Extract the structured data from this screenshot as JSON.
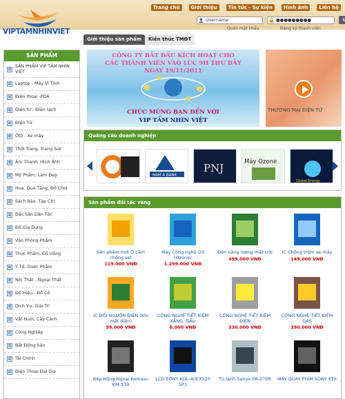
{
  "brand": {
    "logo_text": "VIPTAMNHINVIET"
  },
  "nav": [
    "Trang chủ",
    "Giới thiệu",
    "Tin tức - Sự kiện",
    "Hình ảnh",
    "Liên hệ"
  ],
  "login": {
    "username_value": "Username",
    "password_value": "●●●●●●●●●",
    "button": "Login",
    "forgot": "Quên mật khẩu",
    "register": "Đăng ký thành viên"
  },
  "tabs": [
    "Giới thiệu sản phẩm",
    "Kiến thức TMĐT"
  ],
  "sidebar": {
    "title": "SẢN PHẨM",
    "items": [
      "SẢN PHẨM VIP TẦM NHÌN VIỆT",
      "Laptop - Máy Vi Tính",
      "Điện thoại -PDA",
      "Điện tử - Điện lạnh",
      "Điện Tử",
      "Ôtô - Xe máy",
      "Thời Trang, Trang Sức",
      "Âm Thanh, Hình Ảnh",
      "Mỹ Phẩm, Làm Đẹp",
      "Hoa, Quà Tặng, Đồ Chơi",
      "Sách Báo, Tạp Chí",
      "Đặc Sản Dân Tộc",
      "Đồ Gia Dụng",
      "Văn Phòng Phẩm",
      "Thực Phẩm, Đồ Uống",
      "Y Tế, Dược Phẩm",
      "Nội Thất - Ngoại Thất",
      "Đồ Hiệu - Đồ Cổ",
      "Dịch Vụ, Giải Trí",
      "Vật Nuôi, Cây Cảnh",
      "Công Nghiệp",
      "Bất Động Sản",
      "Tài Chính",
      "Điện Thoại Đại Gia"
    ]
  },
  "banner": {
    "line1": "CÔNG TY  BẮT ĐẦU KÍCH HOẠT CHO",
    "line2": "CÁC THÀNH VIÊN VÀO LÚC 9H THỨ BẢY",
    "line3": "NGÀY 19/11/2011",
    "line4": "CHÚC MỪNG BẠN ĐẾN VỚI",
    "line5": "VIP TẦM NHÌN VIỆT"
  },
  "side_ad": {
    "text": "THƯƠNG MẠI ĐIỆN TỬ"
  },
  "ads_section": {
    "title": "Quảng cáo doanh nghiệp",
    "logos": [
      "S",
      "NAM A BANK",
      "PNJ",
      "Máy Ozone",
      "Global Energy"
    ]
  },
  "products_section": {
    "title": "Sản phẩm đối tác vàng",
    "items": [
      {
        "name": "Sản phẩm mới Ổ cắm chống sét",
        "price": "119.000 VNĐ"
      },
      {
        "name": "Máy Công nghệ O3 (Ozone)",
        "price": "1.299.000 VNĐ"
      },
      {
        "name": "Đèn năng lượng mặt trời",
        "price": "499.000 VNĐ"
      },
      {
        "name": "IC Chống trộm xe máy",
        "price": "149.000 VNĐ"
      },
      {
        "name": "IC ĐỔI NGUỒN ĐIỆN (Khi mất điện)",
        "price": "99.000 VNĐ"
      },
      {
        "name": "CÔNG NGHỆ TIẾT KIỆM XĂNG, DẦU",
        "price": "6.000 VNĐ"
      },
      {
        "name": "CÔNG NGHỆ TIẾT KIỆM ĐIỆN",
        "price": "330.000 VNĐ"
      },
      {
        "name": "CÔNG NGHỆ TIẾT KIỆM GAS",
        "price": "390.000 VNĐ"
      },
      {
        "name": "Bếp Hồng Ngoại Komasu KM-539",
        "price": ""
      },
      {
        "name": "LCD SONY KDL-40EX520 SP1",
        "price": ""
      },
      {
        "name": "Tủ lạnh Sanyo SR-270R",
        "price": ""
      },
      {
        "name": "MÁY QUAY PHIM SONY KTS",
        "price": ""
      }
    ]
  },
  "colors": {
    "green": "#5a9a2e",
    "brand_blue": "#1d56a8",
    "price_red": "#cc0000",
    "orange": "#f07c1a"
  }
}
